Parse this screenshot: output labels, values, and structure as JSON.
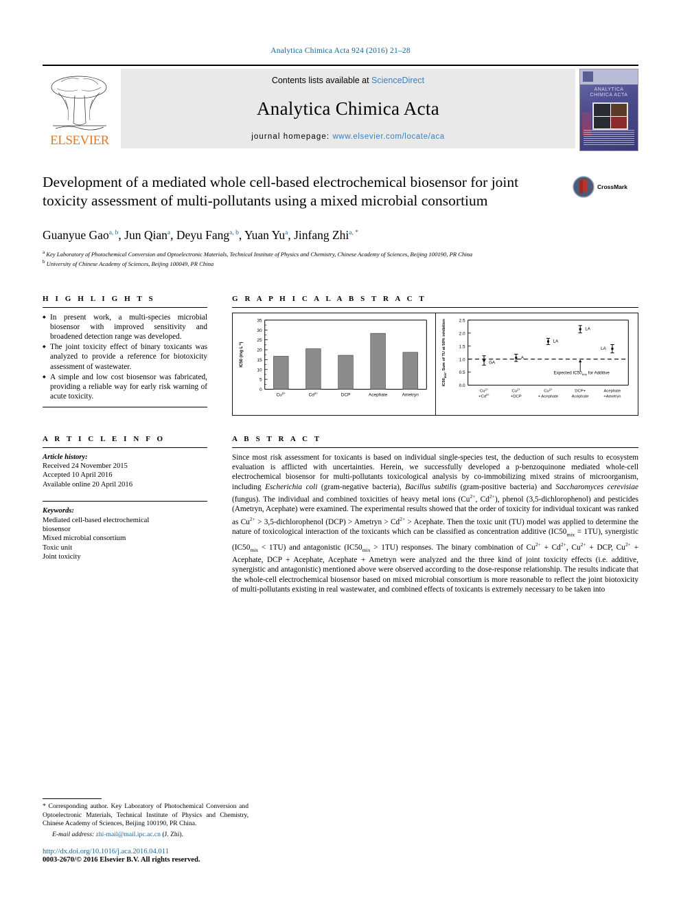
{
  "journal_header": "Analytica Chimica Acta 924 (2016) 21–28",
  "masthead": {
    "contents_prefix": "Contents lists available at ",
    "sciencedirect": "ScienceDirect",
    "journal_title": "Analytica Chimica Acta",
    "homepage_label": "journal homepage: ",
    "homepage_url": "www.elsevier.com/locate/aca",
    "publisher": "ELSEVIER",
    "cover_title_line1": "ANALYTICA",
    "cover_title_line2": "CHIMICA ACTA"
  },
  "article": {
    "title": "Development of a mediated whole cell-based electrochemical biosensor for joint toxicity assessment of multi-pollutants using a mixed microbial consortium",
    "crossmark_label": "CrossMark",
    "authors": [
      {
        "name": "Guanyue Gao",
        "sup": "a, b",
        "sep": ", "
      },
      {
        "name": "Jun Qian",
        "sup": "a",
        "sep": ", "
      },
      {
        "name": "Deyu Fang",
        "sup": "a, b",
        "sep": ", "
      },
      {
        "name": "Yuan Yu",
        "sup": "a",
        "sep": ", "
      },
      {
        "name": "Jinfang Zhi",
        "sup": "a, *",
        "sep": ""
      }
    ],
    "affiliation_a": "Key Laboratory of Photochemical Conversion and Optoelectronic Materials, Technical Institute of Physics and Chemistry, Chinese Academy of Sciences, Beijing 100190, PR China",
    "affiliation_b": "University of Chinese Academy of Sciences, Beijing 100049, PR China"
  },
  "highlights": {
    "heading": "H I G H L I G H T S",
    "items": [
      "In present work, a multi-species microbial biosensor with improved sensitivity and broadened detection range was developed.",
      "The joint toxicity effect of binary toxicants was analyzed to provide a reference for biotoxicity assessment of wastewater.",
      "A simple and low cost biosensor was fabricated, providing a reliable way for early risk warning of acute toxicity."
    ]
  },
  "graphical_abstract": {
    "heading": "G R A P H I C A L   A B S T R A C T"
  },
  "article_info": {
    "heading": "A R T I C L E   I N F O",
    "history_label": "Article history:",
    "received": "Received 24 November 2015",
    "accepted": "Accepted 10 April 2016",
    "available": "Available online 20 April 2016",
    "keywords_label": "Keywords:",
    "keywords": [
      "Mediated cell-based electrochemical",
      "biosensor",
      "Mixed microbial consortium",
      "Toxic unit",
      "Joint toxicity"
    ]
  },
  "abstract": {
    "heading": "A B S T R A C T",
    "paragraphs": [
      "Since most risk assessment for toxicants is based on individual single-species test, the deduction of such results to ecosystem evaluation is afflicted with uncertainties. Herein, we successfully developed a p-benzoquinone mediated whole-cell electrochemical biosensor for multi-pollutants toxicological analysis by co-immobilizing mixed strains of microorganism, including Escherichia coli (gram-negative bacteria), Bacillus subtilis (gram-positive bacteria) and Saccharomyces cerevisiae (fungus). The individual and combined toxicities of heavy metal ions (Cu2+, Cd2+), phenol (3,5-dichlorophenol) and pesticides (Ametryn, Acephate) were examined. The experimental results showed that the order of toxicity for individual toxicant was ranked as Cu2+ > 3,5-dichlorophenol (DCP) > Ametryn > Cd2+ > Acephate. Then the toxic unit (TU) model was applied to determine the nature of toxicological interaction of the toxicants which can be classified as concentration additive (IC50mix = 1TU), synergistic (IC50mix < 1TU) and antagonistic (IC50mix > 1TU) responses. The binary combination of Cu2+ + Cd2+, Cu2+ + DCP, Cu2+ + Acephate, DCP + Acephate, Acephate + Ametryn were analyzed and the three kind of joint toxicity effects (i.e. additive, synergistic and antagonistic) mentioned above were observed according to the dose-response relationship. The results indicate that the whole-cell electrochemical biosensor based on mixed microbial consortium is more reasonable to reflect the joint biotoxicity of multi-pollutants existing in real wastewater, and combined effects of toxicants is extremely necessary to be taken into"
    ]
  },
  "footer": {
    "corresponding": "* Corresponding author. Key Laboratory of Photochemical Conversion and Optoelectronic Materials, Technical Institute of Physics and Chemistry, Chinese Academy of Sciences, Beijing 100190, PR China.",
    "email_label": "E-mail address: ",
    "email": "zhi-mail@mail.ipc.ac.cn",
    "email_suffix": " (J. Zhi).",
    "doi": "http://dx.doi.org/10.1016/j.aca.2016.04.011",
    "copyright": "0003-2670/© 2016 Elsevier B.V. All rights reserved."
  },
  "chart_data": [
    {
      "type": "bar",
      "title": "",
      "ylabel": "IC50 (mg L⁻¹)",
      "xlabel": "",
      "categories": [
        "Cu2+",
        "Cd2+",
        "DCP",
        "Acephate",
        "Ametryn"
      ],
      "values": [
        16.7,
        20.5,
        17.2,
        28.3,
        18.7
      ],
      "ylim": [
        0,
        35
      ],
      "yticks": [
        0,
        5,
        10,
        15,
        20,
        25,
        30,
        35
      ],
      "grid": false,
      "bar_color": "#8c8c8c"
    },
    {
      "type": "scatter",
      "title": "",
      "ylabel": "IC50mix, Sum of TU at 50% inhibition",
      "xlabel": "",
      "categories": [
        "Cu2+ +Cd2+",
        "Cu2+ +DCP",
        "Cu2+ + Acephate",
        "DCP+ Acephate",
        "Acephate +Ametryn"
      ],
      "values": [
        0.95,
        1.05,
        1.68,
        2.15,
        1.4
      ],
      "errors": [
        0.18,
        0.14,
        0.12,
        0.14,
        0.16
      ],
      "point_labels": [
        "GA",
        "A",
        "LA",
        "LA",
        "LA"
      ],
      "reference_line": 1.0,
      "annotation": "Expected IC50mix for Additive",
      "ylim": [
        0.0,
        2.5
      ],
      "yticks": [
        0.0,
        0.5,
        1.0,
        1.5,
        2.0,
        2.5
      ],
      "grid": false
    }
  ]
}
